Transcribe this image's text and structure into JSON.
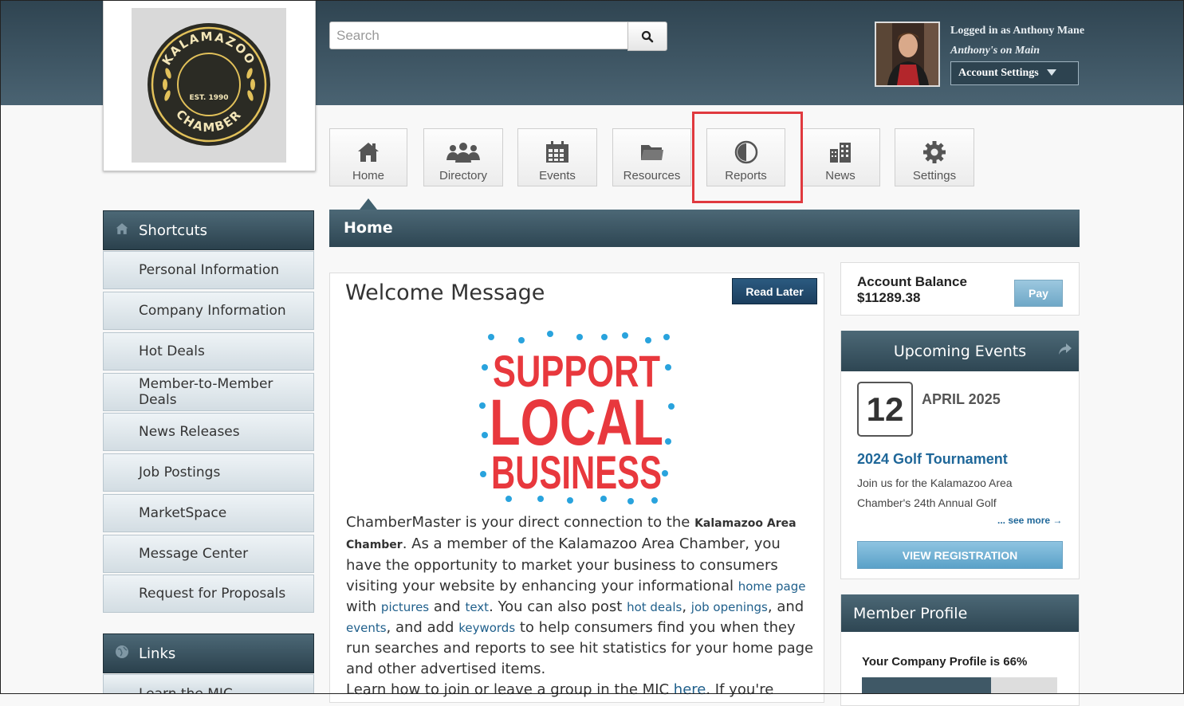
{
  "logo": {
    "top_text": "KALAMAZOO",
    "middle_text": "EST. 1990",
    "bottom_text": "CHAMBER"
  },
  "search": {
    "placeholder": "Search"
  },
  "user": {
    "logged_in": "Logged in as Anthony Mane",
    "company": "Anthony's on Main",
    "account_settings": "Account Settings"
  },
  "nav": {
    "home": "Home",
    "directory": "Directory",
    "events": "Events",
    "resources": "Resources",
    "reports": "Reports",
    "news": "News",
    "settings": "Settings"
  },
  "section_title": "Home",
  "sidebar": {
    "shortcuts_title": "Shortcuts",
    "items": [
      "Personal Information",
      "Company Information",
      "Hot Deals",
      "Member-to-Member Deals",
      "News Releases",
      "Job Postings",
      "MarketSpace",
      "Message Center",
      "Request for Proposals"
    ],
    "links_title": "Links",
    "links_partial": "Learn the MIC"
  },
  "welcome": {
    "title": "Welcome Message",
    "read_later": "Read Later",
    "image_lines": [
      "SUPPORT",
      "LOCAL",
      "BUSINESS"
    ],
    "p1": "ChamberMaster is your direct connection to the ",
    "p1_bold": "Kalamazoo Area Chamber",
    "p2": ". As a member of the Kalamazoo Area Chamber, you have the opportunity to market your business to consumers visiting your website by enhancing your informational ",
    "link_home_page": "home page",
    "p3": " with ",
    "link_pictures": "pictures",
    "p4": " and ",
    "link_text": "text",
    "p5": ". You can also post ",
    "link_hot_deals": "hot deals",
    "p6": ", ",
    "link_job_openings": "job openings",
    "p7": ", and ",
    "link_events": "events",
    "p8": ", and add ",
    "link_keywords": "keywords",
    "p9": " to help consumers find you when they run searches and reports to see hit statistics for your home page and other advertised items.",
    "p10": "Learn how to join or leave a group in the MIC ",
    "link_here": "here",
    "p11": ". If you're"
  },
  "balance": {
    "label": "Account Balance",
    "amount": "$11289.38",
    "pay": "Pay"
  },
  "events": {
    "title": "Upcoming Events",
    "day": "12",
    "month": "APRIL 2025",
    "event_title": "2024 Golf Tournament",
    "description": "Join us for the Kalamazoo Area Chamber's 24th Annual Golf",
    "see_more": "... see more →",
    "view_registration": "VIEW REGISTRATION"
  },
  "member_profile": {
    "title": "Member Profile",
    "completion_label": "Your Company Profile is 66%",
    "completion_fraction": 0.66
  },
  "colors": {
    "header_dark": "#2f4451",
    "accent_blue": "#1f6799",
    "highlight_red": "#e0393e",
    "logo_gold": "#e2c15a",
    "logo_dark": "#2b2b24",
    "support_red": "#e8383d",
    "dot_blue": "#29a3dd"
  }
}
